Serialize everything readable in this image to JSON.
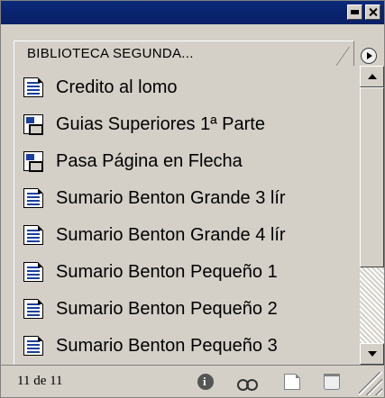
{
  "panel": {
    "tab_label": "BIBLIOTECA SEGUNDA...",
    "status_count": "11 de 11"
  },
  "items": [
    {
      "label": "Credito al lomo",
      "icon": "text-document-icon"
    },
    {
      "label": "Guias Superiores 1ª Parte",
      "icon": "placed-image-document-icon"
    },
    {
      "label": "Pasa Página en Flecha",
      "icon": "placed-image-document-icon"
    },
    {
      "label": "Sumario Benton Grande 3 lír",
      "icon": "text-document-icon"
    },
    {
      "label": "Sumario Benton Grande 4 lír",
      "icon": "text-document-icon"
    },
    {
      "label": "Sumario Benton Pequeño 1",
      "icon": "text-document-icon"
    },
    {
      "label": "Sumario Benton Pequeño 2",
      "icon": "text-document-icon"
    },
    {
      "label": "Sumario Benton Pequeño 3",
      "icon": "text-document-icon"
    }
  ]
}
